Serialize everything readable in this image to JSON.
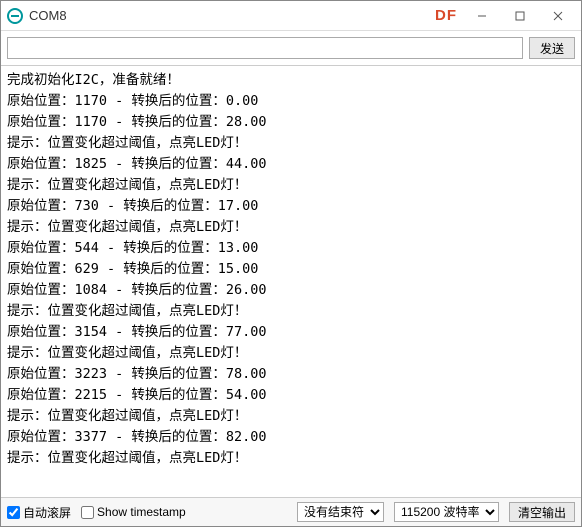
{
  "window": {
    "title": "COM8",
    "badge": "DF",
    "min_label": "–",
    "max_label": "▢",
    "close_label": "×"
  },
  "topbar": {
    "input_value": "",
    "input_placeholder": "",
    "send_label": "发送"
  },
  "output_lines": [
    "完成初始化I2C，准备就绪！",
    "原始位置：1170 - 转换后的位置：0.00",
    "原始位置：1170 - 转换后的位置：28.00",
    "提示：位置变化超过阈值，点亮LED灯！",
    "原始位置：1825 - 转换后的位置：44.00",
    "提示：位置变化超过阈值，点亮LED灯！",
    "原始位置：730 - 转换后的位置：17.00",
    "提示：位置变化超过阈值，点亮LED灯！",
    "原始位置：544 - 转换后的位置：13.00",
    "原始位置：629 - 转换后的位置：15.00",
    "原始位置：1084 - 转换后的位置：26.00",
    "提示：位置变化超过阈值，点亮LED灯！",
    "原始位置：3154 - 转换后的位置：77.00",
    "提示：位置变化超过阈值，点亮LED灯！",
    "原始位置：3223 - 转换后的位置：78.00",
    "原始位置：2215 - 转换后的位置：54.00",
    "提示：位置变化超过阈值，点亮LED灯！",
    "原始位置：3377 - 转换后的位置：82.00",
    "提示：位置变化超过阈值，点亮LED灯！"
  ],
  "statusbar": {
    "autoscroll_label": "自动滚屏",
    "autoscroll_checked": true,
    "timestamp_label": "Show timestamp",
    "timestamp_checked": false,
    "line_ending_selected": "没有结束符",
    "baud_selected": "115200 波特率",
    "clear_label": "清空输出"
  }
}
